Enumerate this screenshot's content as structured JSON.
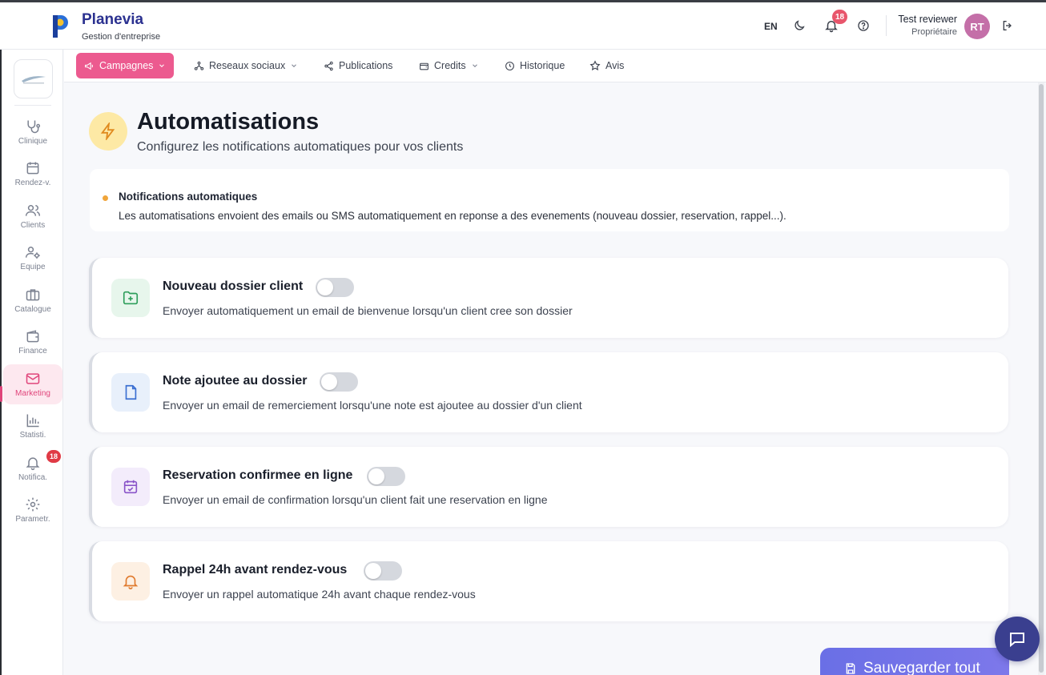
{
  "brand": {
    "name": "Planevia",
    "subtitle": "Gestion d'entreprise"
  },
  "header": {
    "language": "EN",
    "notification_count": "18",
    "user_name": "Test reviewer",
    "user_role": "Propriétaire",
    "avatar_initials": "RT"
  },
  "sidebar": {
    "items": [
      {
        "label": "Clinique",
        "icon": "stethoscope-icon"
      },
      {
        "label": "Rendez-v.",
        "icon": "calendar-icon"
      },
      {
        "label": "Clients",
        "icon": "users-icon"
      },
      {
        "label": "Equipe",
        "icon": "user-gear-icon"
      },
      {
        "label": "Catalogue",
        "icon": "briefcase-icon"
      },
      {
        "label": "Finance",
        "icon": "wallet-icon"
      },
      {
        "label": "Marketing",
        "icon": "mail-icon",
        "active": true
      },
      {
        "label": "Statisti.",
        "icon": "bar-chart-icon"
      },
      {
        "label": "Notifica.",
        "icon": "bell-icon",
        "badge": "18"
      },
      {
        "label": "Parametr.",
        "icon": "gear-icon"
      }
    ]
  },
  "tabs": [
    {
      "label": "Campagnes",
      "icon": "megaphone-icon",
      "active": true,
      "dropdown": true
    },
    {
      "label": "Reseaux sociaux",
      "icon": "network-icon",
      "dropdown": true
    },
    {
      "label": "Publications",
      "icon": "share-icon"
    },
    {
      "label": "Credits",
      "icon": "wallet-icon",
      "dropdown": true
    },
    {
      "label": "Historique",
      "icon": "clock-icon"
    },
    {
      "label": "Avis",
      "icon": "star-icon"
    }
  ],
  "page": {
    "title": "Automatisations",
    "subtitle": "Configurez les notifications automatiques pour vos clients"
  },
  "info": {
    "title": "Notifications automatiques",
    "text": "Les automatisations envoient des emails ou SMS automatiquement en reponse a des evenements (nouveau dossier, reservation, rappel...)."
  },
  "automations": [
    {
      "title": "Nouveau dossier client",
      "description": "Envoyer automatiquement un email de bienvenue lorsqu'un client cree son dossier",
      "icon": "folder-plus-icon",
      "enabled": false,
      "color": "#2e9e5b"
    },
    {
      "title": "Note ajoutee au dossier",
      "description": "Envoyer un email de remerciement lorsqu'une note est ajoutee au dossier d'un client",
      "icon": "file-icon",
      "enabled": false,
      "color": "#3b6fd1"
    },
    {
      "title": "Reservation confirmee en ligne",
      "description": "Envoyer un email de confirmation lorsqu'un client fait une reservation en ligne",
      "icon": "calendar-check-icon",
      "enabled": false,
      "color": "#8a55c9"
    },
    {
      "title": "Rappel 24h avant rendez-vous",
      "description": "Envoyer un rappel automatique 24h avant chaque rendez-vous",
      "icon": "bell-icon",
      "enabled": false,
      "color": "#e07a2e"
    }
  ],
  "save_button": {
    "label": "Sauvegarder tout"
  },
  "colors": {
    "accent": "#ec5a8f",
    "brand": "#2b3190",
    "save": "#6a6fe6"
  }
}
